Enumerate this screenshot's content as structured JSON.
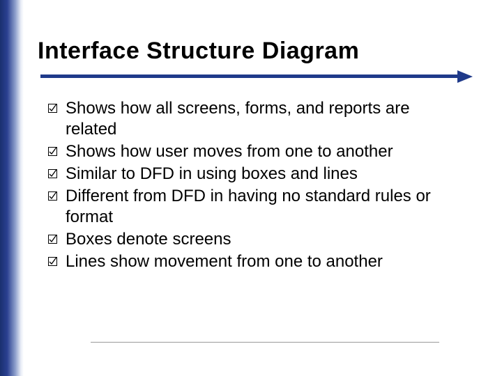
{
  "title": "Interface Structure Diagram",
  "bullets": [
    "Shows how all screens, forms, and reports are related",
    "Shows how user moves from one to another",
    "Similar to DFD in using boxes and lines",
    "Different from DFD in having no standard rules or format",
    "Boxes denote screens",
    "Lines show movement from one to another"
  ]
}
